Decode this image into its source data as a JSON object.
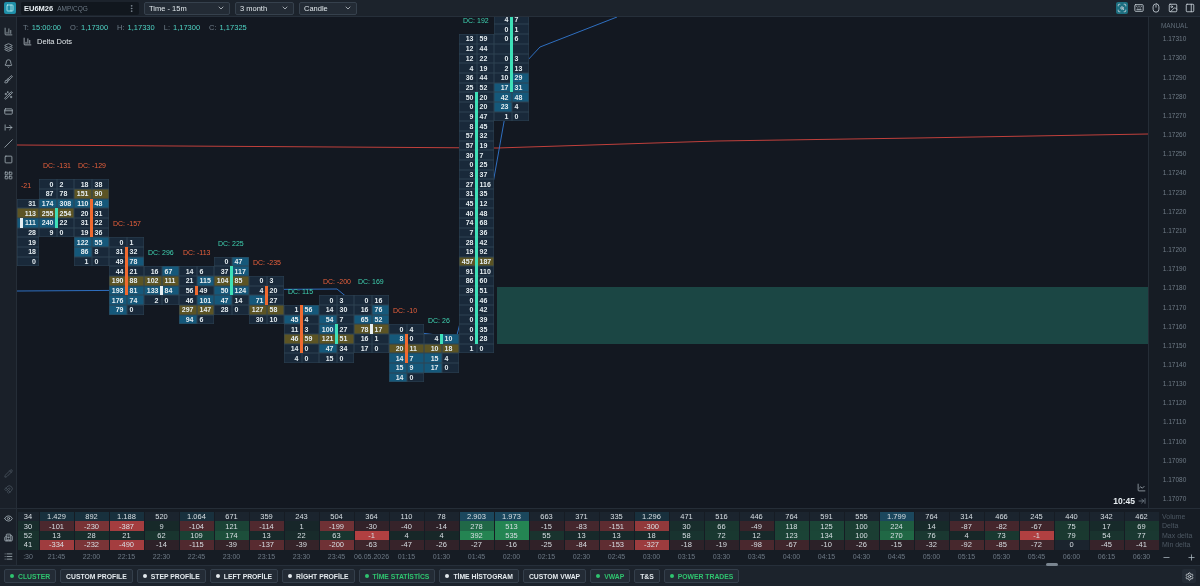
{
  "toolbar": {
    "symbol": "EU6M26",
    "feed": "AMP/CQG",
    "dropdowns": [
      "Time - 15m",
      "3 month",
      "Candle"
    ]
  },
  "ohlc": [
    {
      "label": "T:",
      "value": "15:00:00"
    },
    {
      "label": "O:",
      "value": "1,17300"
    },
    {
      "label": "H:",
      "value": "1,17330"
    },
    {
      "label": "L:",
      "value": "1,17300"
    },
    {
      "label": "C:",
      "value": "1,17325"
    }
  ],
  "indicator": "Delta Dots",
  "price_axis": {
    "mode": "MANUAL",
    "ticks": [
      "1.17310",
      "1.17300",
      "1.17290",
      "1.17280",
      "1.17270",
      "1.17260",
      "1.17250",
      "1.17240",
      "1.17230",
      "1.17220",
      "1.17210",
      "1.17200",
      "1.17190",
      "1.17180",
      "1.17170",
      "1.17160",
      "1.17150",
      "1.17140",
      "1.17130",
      "1.17120",
      "1.17110",
      "1.17100",
      "1.17090",
      "1.17080",
      "1.17070"
    ]
  },
  "current_time": "10:45",
  "stat_labels": [
    "Volume",
    "Delta",
    "Max delta",
    "Min delta"
  ],
  "columns": [
    {
      "time": ":30",
      "volume": "34",
      "delta": "30",
      "max_delta": "52",
      "min_delta": "41",
      "cut_off": true,
      "cluster": {
        "label": "-21",
        "negative": true,
        "kind": "doji",
        "rows": [
          null,
          null,
          null,
          null,
          null,
          null,
          null,
          null,
          null,
          null,
          null,
          null,
          null,
          null,
          null,
          null,
          null,
          null,
          null,
          {
            "ask": "31",
            "poc": false,
            "body": false
          },
          {
            "ask": "113",
            "poc": true,
            "body": false
          },
          {
            "ask": "111",
            "poc": false,
            "body": true
          },
          {
            "ask": "28",
            "poc": false,
            "body": false
          },
          {
            "ask": "19",
            "poc": false,
            "body": false
          },
          {
            "ask": "18",
            "poc": false,
            "body": false
          },
          {
            "ask": "0",
            "poc": false,
            "body": false
          }
        ]
      }
    },
    {
      "time": "21:45",
      "volume": "1.429",
      "delta": "-101",
      "max_delta": "13",
      "min_delta": "-334",
      "cut_off": false,
      "cluster": {
        "label": "DC: -131",
        "negative": true,
        "kind": "up",
        "rows": [
          null,
          null,
          null,
          null,
          null,
          null,
          null,
          null,
          null,
          null,
          null,
          null,
          null,
          null,
          null,
          null,
          null,
          {
            "bid": "0",
            "ask": "2",
            "poc": false,
            "body": false
          },
          {
            "bid": "87",
            "ask": "78",
            "poc": false,
            "body": false
          },
          {
            "bid": "174",
            "ask": "308",
            "poc": false,
            "body": false
          },
          {
            "bid": "255",
            "ask": "254",
            "poc": true,
            "body": true
          },
          {
            "bid": "240",
            "ask": "22",
            "poc": false,
            "body": true
          },
          {
            "bid": "9",
            "ask": "0",
            "poc": false,
            "body": false
          }
        ]
      }
    },
    {
      "time": "22:00",
      "volume": "892",
      "delta": "-230",
      "max_delta": "28",
      "min_delta": "-232",
      "cut_off": false,
      "cluster": {
        "label": "DC: -129",
        "negative": true,
        "kind": "down",
        "rows": [
          null,
          null,
          null,
          null,
          null,
          null,
          null,
          null,
          null,
          null,
          null,
          null,
          null,
          null,
          null,
          null,
          null,
          {
            "bid": "18",
            "ask": "38",
            "poc": false,
            "body": false
          },
          {
            "bid": "151",
            "ask": "90",
            "poc": true,
            "body": false
          },
          {
            "bid": "110",
            "ask": "48",
            "poc": false,
            "body": true
          },
          {
            "bid": "20",
            "ask": "31",
            "poc": false,
            "body": true
          },
          {
            "bid": "31",
            "ask": "22",
            "poc": false,
            "body": true
          },
          {
            "bid": "19",
            "ask": "36",
            "poc": false,
            "body": true
          },
          {
            "bid": "122",
            "ask": "55",
            "poc": false,
            "body": false
          },
          {
            "bid": "86",
            "ask": "8",
            "poc": false,
            "body": false
          },
          {
            "bid": "1",
            "ask": "0",
            "poc": false,
            "body": false
          }
        ]
      }
    },
    {
      "time": "22:15",
      "volume": "1.188",
      "delta": "-387",
      "max_delta": "21",
      "min_delta": "-490",
      "cut_off": false,
      "cluster": {
        "label": "DC: -157",
        "negative": true,
        "kind": "down",
        "rows": [
          null,
          null,
          null,
          null,
          null,
          null,
          null,
          null,
          null,
          null,
          null,
          null,
          null,
          null,
          null,
          null,
          null,
          null,
          null,
          null,
          null,
          null,
          null,
          {
            "bid": "0",
            "ask": "1",
            "poc": false,
            "body": false
          },
          {
            "bid": "31",
            "ask": "32",
            "poc": false,
            "body": true
          },
          {
            "bid": "49",
            "ask": "78",
            "poc": false,
            "body": true
          },
          {
            "bid": "44",
            "ask": "21",
            "poc": false,
            "body": true
          },
          {
            "bid": "190",
            "ask": "88",
            "poc": true,
            "body": true
          },
          {
            "bid": "193",
            "ask": "81",
            "poc": false,
            "body": true
          },
          {
            "bid": "176",
            "ask": "74",
            "poc": false,
            "body": false
          },
          {
            "bid": "79",
            "ask": "0",
            "poc": false,
            "body": false
          }
        ]
      }
    },
    {
      "time": "22:30",
      "volume": "520",
      "delta": "9",
      "max_delta": "62",
      "min_delta": "-14",
      "cut_off": false,
      "cluster": {
        "label": "DC: 296",
        "negative": false,
        "kind": "doji",
        "rows": [
          null,
          null,
          null,
          null,
          null,
          null,
          null,
          null,
          null,
          null,
          null,
          null,
          null,
          null,
          null,
          null,
          null,
          null,
          null,
          null,
          null,
          null,
          null,
          null,
          null,
          null,
          {
            "bid": "16",
            "ask": "67",
            "poc": false,
            "body": false
          },
          {
            "bid": "102",
            "ask": "111",
            "poc": true,
            "body": false
          },
          {
            "bid": "133",
            "ask": "84",
            "poc": false,
            "body": true
          },
          {
            "bid": "2",
            "ask": "0",
            "poc": false,
            "body": false
          }
        ]
      }
    },
    {
      "time": "22:45",
      "volume": "1.064",
      "delta": "-104",
      "max_delta": "109",
      "min_delta": "-115",
      "cut_off": false,
      "cluster": {
        "label": "DC: -113",
        "negative": true,
        "kind": "down",
        "rows": [
          null,
          null,
          null,
          null,
          null,
          null,
          null,
          null,
          null,
          null,
          null,
          null,
          null,
          null,
          null,
          null,
          null,
          null,
          null,
          null,
          null,
          null,
          null,
          null,
          null,
          null,
          {
            "bid": "14",
            "ask": "6",
            "poc": false,
            "body": false
          },
          {
            "bid": "21",
            "ask": "115",
            "poc": false,
            "body": false
          },
          {
            "bid": "56",
            "ask": "49",
            "poc": false,
            "body": true
          },
          {
            "bid": "46",
            "ask": "101",
            "poc": false,
            "body": false
          },
          {
            "bid": "297",
            "ask": "147",
            "poc": true,
            "body": false
          },
          {
            "bid": "94",
            "ask": "6",
            "poc": false,
            "body": false
          }
        ]
      }
    },
    {
      "time": "23:00",
      "volume": "671",
      "delta": "121",
      "max_delta": "174",
      "min_delta": "-39",
      "cut_off": false,
      "cluster": {
        "label": "DC: 225",
        "negative": false,
        "kind": "up",
        "rows": [
          null,
          null,
          null,
          null,
          null,
          null,
          null,
          null,
          null,
          null,
          null,
          null,
          null,
          null,
          null,
          null,
          null,
          null,
          null,
          null,
          null,
          null,
          null,
          null,
          null,
          {
            "bid": "0",
            "ask": "47",
            "poc": false,
            "body": false
          },
          {
            "bid": "37",
            "ask": "117",
            "poc": false,
            "body": true
          },
          {
            "bid": "104",
            "ask": "85",
            "poc": true,
            "body": true
          },
          {
            "bid": "50",
            "ask": "124",
            "poc": false,
            "body": true
          },
          {
            "bid": "47",
            "ask": "14",
            "poc": false,
            "body": false
          },
          {
            "bid": "28",
            "ask": "0",
            "poc": false,
            "body": false
          }
        ]
      }
    },
    {
      "time": "23:15",
      "volume": "359",
      "delta": "-114",
      "max_delta": "13",
      "min_delta": "-137",
      "cut_off": false,
      "cluster": {
        "label": "DC: -235",
        "negative": true,
        "kind": "down",
        "rows": [
          null,
          null,
          null,
          null,
          null,
          null,
          null,
          null,
          null,
          null,
          null,
          null,
          null,
          null,
          null,
          null,
          null,
          null,
          null,
          null,
          null,
          null,
          null,
          null,
          null,
          null,
          null,
          {
            "bid": "0",
            "ask": "3",
            "poc": false,
            "body": false
          },
          {
            "bid": "4",
            "ask": "20",
            "poc": false,
            "body": true
          },
          {
            "bid": "71",
            "ask": "27",
            "poc": false,
            "body": true
          },
          {
            "bid": "127",
            "ask": "58",
            "poc": true,
            "body": false
          },
          {
            "bid": "30",
            "ask": "10",
            "poc": false,
            "body": false
          }
        ]
      }
    },
    {
      "time": "23:30",
      "volume": "243",
      "delta": "1",
      "max_delta": "22",
      "min_delta": "-39",
      "cut_off": false,
      "cluster": {
        "label": "DC: 115",
        "negative": false,
        "kind": "down",
        "rows": [
          null,
          null,
          null,
          null,
          null,
          null,
          null,
          null,
          null,
          null,
          null,
          null,
          null,
          null,
          null,
          null,
          null,
          null,
          null,
          null,
          null,
          null,
          null,
          null,
          null,
          null,
          null,
          null,
          null,
          null,
          {
            "bid": "1",
            "ask": "56",
            "poc": false,
            "body": true
          },
          {
            "bid": "45",
            "ask": "4",
            "poc": false,
            "body": true
          },
          {
            "bid": "11",
            "ask": "3",
            "poc": false,
            "body": true
          },
          {
            "bid": "46",
            "ask": "59",
            "poc": true,
            "body": true
          },
          {
            "bid": "14",
            "ask": "0",
            "poc": false,
            "body": true
          },
          {
            "bid": "4",
            "ask": "0",
            "poc": false,
            "body": false
          }
        ]
      }
    },
    {
      "time": "23:45",
      "volume": "504",
      "delta": "-199",
      "max_delta": "63",
      "min_delta": "-200",
      "cut_off": false,
      "cluster": {
        "label": "DC: -200",
        "negative": true,
        "kind": "up",
        "rows": [
          null,
          null,
          null,
          null,
          null,
          null,
          null,
          null,
          null,
          null,
          null,
          null,
          null,
          null,
          null,
          null,
          null,
          null,
          null,
          null,
          null,
          null,
          null,
          null,
          null,
          null,
          null,
          null,
          null,
          {
            "bid": "0",
            "ask": "3",
            "poc": false,
            "body": false
          },
          {
            "bid": "14",
            "ask": "30",
            "poc": false,
            "body": false
          },
          {
            "bid": "54",
            "ask": "7",
            "poc": false,
            "body": false
          },
          {
            "bid": "100",
            "ask": "27",
            "poc": false,
            "body": true
          },
          {
            "bid": "121",
            "ask": "51",
            "poc": true,
            "body": true
          },
          {
            "bid": "47",
            "ask": "34",
            "poc": false,
            "body": false
          },
          {
            "bid": "15",
            "ask": "0",
            "poc": false,
            "body": false
          }
        ]
      }
    },
    {
      "time": "06.05.2026",
      "volume": "364",
      "delta": "-30",
      "max_delta": "-1",
      "min_delta": "-63",
      "cut_off": false,
      "cluster": {
        "label": "DC: 169",
        "negative": false,
        "kind": "doji",
        "rows": [
          null,
          null,
          null,
          null,
          null,
          null,
          null,
          null,
          null,
          null,
          null,
          null,
          null,
          null,
          null,
          null,
          null,
          null,
          null,
          null,
          null,
          null,
          null,
          null,
          null,
          null,
          null,
          null,
          null,
          {
            "bid": "0",
            "ask": "16",
            "poc": false,
            "body": false
          },
          {
            "bid": "16",
            "ask": "76",
            "poc": false,
            "body": false
          },
          {
            "bid": "65",
            "ask": "52",
            "poc": false,
            "body": false
          },
          {
            "bid": "78",
            "ask": "17",
            "poc": true,
            "body": true
          },
          {
            "bid": "16",
            "ask": "1",
            "poc": false,
            "body": false
          },
          {
            "bid": "17",
            "ask": "0",
            "poc": false,
            "body": false
          }
        ]
      }
    },
    {
      "time": "01:15",
      "volume": "110",
      "delta": "-40",
      "max_delta": "4",
      "min_delta": "-47",
      "cut_off": false,
      "cluster": {
        "label": "DC: -10",
        "negative": true,
        "kind": "down",
        "rows": [
          null,
          null,
          null,
          null,
          null,
          null,
          null,
          null,
          null,
          null,
          null,
          null,
          null,
          null,
          null,
          null,
          null,
          null,
          null,
          null,
          null,
          null,
          null,
          null,
          null,
          null,
          null,
          null,
          null,
          null,
          null,
          null,
          {
            "bid": "0",
            "ask": "4",
            "poc": false,
            "body": false
          },
          {
            "bid": "8",
            "ask": "0",
            "poc": false,
            "body": true
          },
          {
            "bid": "20",
            "ask": "11",
            "poc": true,
            "body": true
          },
          {
            "bid": "14",
            "ask": "7",
            "poc": false,
            "body": true
          },
          {
            "bid": "15",
            "ask": "9",
            "poc": false,
            "body": false
          },
          {
            "bid": "14",
            "ask": "0",
            "poc": false,
            "body": false
          }
        ]
      }
    },
    {
      "time": "01:30",
      "volume": "78",
      "delta": "-14",
      "max_delta": "4",
      "min_delta": "-26",
      "cut_off": false,
      "cluster": {
        "label": "DC: 26",
        "negative": false,
        "kind": "up",
        "rows": [
          null,
          null,
          null,
          null,
          null,
          null,
          null,
          null,
          null,
          null,
          null,
          null,
          null,
          null,
          null,
          null,
          null,
          null,
          null,
          null,
          null,
          null,
          null,
          null,
          null,
          null,
          null,
          null,
          null,
          null,
          null,
          null,
          null,
          {
            "bid": "4",
            "ask": "10",
            "poc": false,
            "body": true
          },
          {
            "bid": "10",
            "ask": "18",
            "poc": true,
            "body": false
          },
          {
            "bid": "15",
            "ask": "4",
            "poc": false,
            "body": false
          },
          {
            "bid": "17",
            "ask": "0",
            "poc": false,
            "body": false
          }
        ]
      }
    },
    {
      "time": "01:45",
      "volume": "2.903",
      "delta": "278",
      "max_delta": "392",
      "min_delta": "-27",
      "cut_off": false,
      "cluster": {
        "label": "DC: 192",
        "negative": false,
        "kind": "up",
        "rows": [
          null,
          null,
          {
            "bid": "13",
            "ask": "59",
            "poc": false,
            "body": false
          },
          {
            "bid": "12",
            "ask": "44",
            "poc": false,
            "body": false
          },
          {
            "bid": "12",
            "ask": "22",
            "poc": false,
            "body": false
          },
          {
            "bid": "4",
            "ask": "19",
            "poc": false,
            "body": false
          },
          {
            "bid": "36",
            "ask": "44",
            "poc": false,
            "body": false
          },
          {
            "bid": "25",
            "ask": "52",
            "poc": false,
            "body": false
          },
          {
            "bid": "50",
            "ask": "20",
            "poc": false,
            "body": true
          },
          {
            "bid": "0",
            "ask": "20",
            "poc": false,
            "body": true
          },
          {
            "bid": "9",
            "ask": "47",
            "poc": false,
            "body": true
          },
          {
            "bid": "8",
            "ask": "45",
            "poc": false,
            "body": true
          },
          {
            "bid": "57",
            "ask": "32",
            "poc": false,
            "body": true
          },
          {
            "bid": "57",
            "ask": "19",
            "poc": false,
            "body": true
          },
          {
            "bid": "30",
            "ask": "7",
            "poc": false,
            "body": true
          },
          {
            "bid": "0",
            "ask": "25",
            "poc": false,
            "body": true
          },
          {
            "bid": "3",
            "ask": "37",
            "poc": false,
            "body": true
          },
          {
            "bid": "27",
            "ask": "116",
            "poc": false,
            "body": true
          },
          {
            "bid": "31",
            "ask": "35",
            "poc": false,
            "body": true
          },
          {
            "bid": "45",
            "ask": "12",
            "poc": false,
            "body": true
          },
          {
            "bid": "40",
            "ask": "48",
            "poc": false,
            "body": true
          },
          {
            "bid": "74",
            "ask": "68",
            "poc": false,
            "body": true
          },
          {
            "bid": "7",
            "ask": "36",
            "poc": false,
            "body": true
          },
          {
            "bid": "28",
            "ask": "42",
            "poc": false,
            "body": true
          },
          {
            "bid": "19",
            "ask": "92",
            "poc": false,
            "body": true
          },
          {
            "bid": "457",
            "ask": "187",
            "poc": true,
            "body": true
          },
          {
            "bid": "91",
            "ask": "110",
            "poc": false,
            "body": true
          },
          {
            "bid": "86",
            "ask": "60",
            "poc": false,
            "body": true
          },
          {
            "bid": "39",
            "ask": "51",
            "poc": false,
            "body": true
          },
          {
            "bid": "0",
            "ask": "46",
            "poc": false,
            "body": true
          },
          {
            "bid": "0",
            "ask": "42",
            "poc": false,
            "body": true
          },
          {
            "bid": "0",
            "ask": "39",
            "poc": false,
            "body": true
          },
          {
            "bid": "0",
            "ask": "35",
            "poc": false,
            "body": true
          },
          {
            "bid": "0",
            "ask": "28",
            "poc": false,
            "body": true
          },
          {
            "bid": "1",
            "ask": "0",
            "poc": false,
            "body": false
          }
        ]
      }
    },
    {
      "time": "02:00",
      "volume": "1.973",
      "delta": "513",
      "max_delta": "535",
      "min_delta": "-16",
      "cut_off": false,
      "cluster": {
        "kind": "up",
        "rows": [
          {
            "bid": "4",
            "ask": "7",
            "poc": false,
            "body": true
          },
          {
            "bid": "0",
            "ask": "1",
            "poc": false,
            "body": true
          },
          {
            "bid": "0",
            "ask": "6",
            "poc": false,
            "body": true
          },
          {
            "poc": false,
            "body": true
          },
          {
            "bid": "0",
            "ask": "3",
            "poc": false,
            "body": true
          },
          {
            "bid": "2",
            "ask": "13",
            "poc": false,
            "body": true
          },
          {
            "bid": "10",
            "ask": "29",
            "poc": false,
            "body": true
          },
          {
            "bid": "17",
            "ask": "31",
            "poc": false,
            "body": true
          },
          {
            "bid": "42",
            "ask": "48",
            "poc": false,
            "body": false
          },
          {
            "bid": "23",
            "ask": "4",
            "poc": false,
            "body": false
          },
          {
            "bid": "1",
            "ask": "0",
            "poc": false,
            "body": false
          }
        ]
      }
    },
    {
      "time": "02:15",
      "volume": "663",
      "delta": "-15",
      "max_delta": "55",
      "min_delta": "-25",
      "cut_off": false
    },
    {
      "time": "02:30",
      "volume": "371",
      "delta": "-83",
      "max_delta": "13",
      "min_delta": "-84",
      "cut_off": false
    },
    {
      "time": "02:45",
      "volume": "335",
      "delta": "-151",
      "max_delta": "13",
      "min_delta": "-153",
      "cut_off": false
    },
    {
      "time": "03:00",
      "volume": "1.296",
      "delta": "-300",
      "max_delta": "18",
      "min_delta": "-327",
      "cut_off": false
    },
    {
      "time": "03:15",
      "volume": "471",
      "delta": "30",
      "max_delta": "58",
      "min_delta": "-18",
      "cut_off": false
    },
    {
      "time": "03:30",
      "volume": "516",
      "delta": "66",
      "max_delta": "72",
      "min_delta": "-19",
      "cut_off": false
    },
    {
      "time": "03:45",
      "volume": "446",
      "delta": "-49",
      "max_delta": "12",
      "min_delta": "-98",
      "cut_off": false
    },
    {
      "time": "04:00",
      "volume": "764",
      "delta": "118",
      "max_delta": "123",
      "min_delta": "-67",
      "cut_off": false
    },
    {
      "time": "04:15",
      "volume": "591",
      "delta": "125",
      "max_delta": "134",
      "min_delta": "-10",
      "cut_off": false
    },
    {
      "time": "04:30",
      "volume": "555",
      "delta": "100",
      "max_delta": "100",
      "min_delta": "-26",
      "cut_off": false
    },
    {
      "time": "04:45",
      "volume": "1.799",
      "delta": "224",
      "max_delta": "270",
      "min_delta": "-15",
      "cut_off": false
    },
    {
      "time": "05:00",
      "volume": "764",
      "delta": "14",
      "max_delta": "76",
      "min_delta": "-32",
      "cut_off": false
    },
    {
      "time": "05:15",
      "volume": "314",
      "delta": "-87",
      "max_delta": "4",
      "min_delta": "-92",
      "cut_off": false
    },
    {
      "time": "05:30",
      "volume": "466",
      "delta": "-82",
      "max_delta": "73",
      "min_delta": "-85",
      "cut_off": false
    },
    {
      "time": "05:45",
      "volume": "245",
      "delta": "-67",
      "max_delta": "-1",
      "min_delta": "-72",
      "cut_off": false
    },
    {
      "time": "06:00",
      "volume": "440",
      "delta": "75",
      "max_delta": "79",
      "min_delta": "0",
      "cut_off": false
    },
    {
      "time": "06:15",
      "volume": "342",
      "delta": "17",
      "max_delta": "54",
      "min_delta": "-45",
      "cut_off": false
    },
    {
      "time": "06:30",
      "volume": "462",
      "delta": "69",
      "max_delta": "77",
      "min_delta": "-41",
      "cut_off": false
    }
  ],
  "modules": [
    {
      "label": "CLUSTER",
      "dot": true,
      "on": true
    },
    {
      "label": "CUSTOM PROFILE",
      "dot": false,
      "on": false
    },
    {
      "label": "STEP PROFİLE",
      "dot": true,
      "on": false
    },
    {
      "label": "LEFT PROFİLE",
      "dot": true,
      "on": false
    },
    {
      "label": "RİGHT PROFİLE",
      "dot": true,
      "on": false
    },
    {
      "label": "TİME STATİSTİCS",
      "dot": true,
      "on": true
    },
    {
      "label": "TİME HİSTOGRAM",
      "dot": true,
      "on": false
    },
    {
      "label": "CUSTOM VWAP",
      "dot": false,
      "on": false
    },
    {
      "label": "VWAP",
      "dot": true,
      "on": true
    },
    {
      "label": "T&S",
      "dot": false,
      "on": false
    },
    {
      "label": "POWER TRADES",
      "dot": true,
      "on": true
    }
  ]
}
